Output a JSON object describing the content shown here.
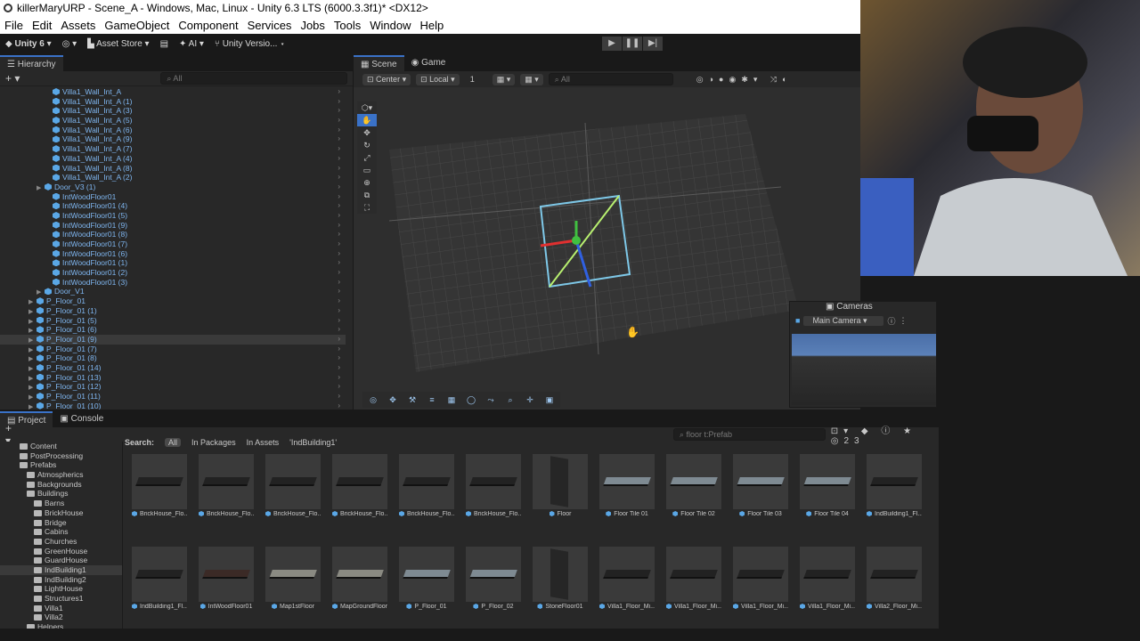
{
  "window_title": "killerMaryURP - Scene_A - Windows, Mac, Linux - Unity 6.3 LTS (6000.3.3f1)* <DX12>",
  "menu": [
    "File",
    "Edit",
    "Assets",
    "GameObject",
    "Component",
    "Services",
    "Jobs",
    "Tools",
    "Window",
    "Help"
  ],
  "toolbar": {
    "account": "Unity 6",
    "asset_store": "Asset Store",
    "ai": "AI",
    "version_control": "Unity Versio..."
  },
  "hierarchy": {
    "tab": "Hierarchy",
    "search_placeholder": "All",
    "rows": [
      {
        "name": "Villa1_Wall_Int_A",
        "indent": 4,
        "selected": false
      },
      {
        "name": "Villa1_Wall_Int_A (1)",
        "indent": 4,
        "selected": false
      },
      {
        "name": "Villa1_Wall_Int_A (3)",
        "indent": 4,
        "selected": false
      },
      {
        "name": "Villa1_Wall_Int_A (5)",
        "indent": 4,
        "selected": false
      },
      {
        "name": "Villa1_Wall_Int_A (6)",
        "indent": 4,
        "selected": false
      },
      {
        "name": "Villa1_Wall_Int_A (9)",
        "indent": 4,
        "selected": false
      },
      {
        "name": "Villa1_Wall_Int_A (7)",
        "indent": 4,
        "selected": false
      },
      {
        "name": "Villa1_Wall_Int_A (4)",
        "indent": 4,
        "selected": false
      },
      {
        "name": "Villa1_Wall_Int_A (8)",
        "indent": 4,
        "selected": false
      },
      {
        "name": "Villa1_Wall_Int_A (2)",
        "indent": 4,
        "selected": false
      },
      {
        "name": "Door_V3 (1)",
        "indent": 3,
        "selected": false
      },
      {
        "name": "IntWoodFloor01",
        "indent": 4,
        "selected": false
      },
      {
        "name": "IntWoodFloor01 (4)",
        "indent": 4,
        "selected": false
      },
      {
        "name": "IntWoodFloor01 (5)",
        "indent": 4,
        "selected": false
      },
      {
        "name": "IntWoodFloor01 (9)",
        "indent": 4,
        "selected": false
      },
      {
        "name": "IntWoodFloor01 (8)",
        "indent": 4,
        "selected": false
      },
      {
        "name": "IntWoodFloor01 (7)",
        "indent": 4,
        "selected": false
      },
      {
        "name": "IntWoodFloor01 (6)",
        "indent": 4,
        "selected": false
      },
      {
        "name": "IntWoodFloor01 (1)",
        "indent": 4,
        "selected": false
      },
      {
        "name": "IntWoodFloor01 (2)",
        "indent": 4,
        "selected": false
      },
      {
        "name": "IntWoodFloor01 (3)",
        "indent": 4,
        "selected": false
      },
      {
        "name": "Door_V1",
        "indent": 3,
        "selected": false
      },
      {
        "name": "P_Floor_01",
        "indent": 2,
        "selected": false
      },
      {
        "name": "P_Floor_01 (1)",
        "indent": 2,
        "selected": false
      },
      {
        "name": "P_Floor_01 (5)",
        "indent": 2,
        "selected": false
      },
      {
        "name": "P_Floor_01 (6)",
        "indent": 2,
        "selected": false
      },
      {
        "name": "P_Floor_01 (9)",
        "indent": 2,
        "selected": true
      },
      {
        "name": "P_Floor_01 (7)",
        "indent": 2,
        "selected": false
      },
      {
        "name": "P_Floor_01 (8)",
        "indent": 2,
        "selected": false
      },
      {
        "name": "P_Floor_01 (14)",
        "indent": 2,
        "selected": false
      },
      {
        "name": "P_Floor_01 (13)",
        "indent": 2,
        "selected": false
      },
      {
        "name": "P_Floor_01 (12)",
        "indent": 2,
        "selected": false
      },
      {
        "name": "P_Floor_01 (11)",
        "indent": 2,
        "selected": false
      },
      {
        "name": "P_Floor_01 (10)",
        "indent": 2,
        "selected": false
      }
    ]
  },
  "scene": {
    "tabs": [
      "Scene",
      "Game"
    ],
    "pivot": "Center",
    "space": "Local",
    "grid_size": "1",
    "search_placeholder": "All"
  },
  "cameras": {
    "title": "Cameras",
    "selected": "Main Camera"
  },
  "project": {
    "tabs": [
      "Project",
      "Console"
    ],
    "search_value": "floor t:Prefab",
    "count": "23",
    "search_label": "Search:",
    "scopes": [
      "All",
      "In Packages",
      "In Assets",
      "'IndBuilding1'"
    ],
    "tree": [
      {
        "name": "Content",
        "indent": 1,
        "selected": false
      },
      {
        "name": "PostProcessing",
        "indent": 1,
        "selected": false
      },
      {
        "name": "Prefabs",
        "indent": 1,
        "selected": false
      },
      {
        "name": "Atmospherics",
        "indent": 2,
        "selected": false
      },
      {
        "name": "Backgrounds",
        "indent": 2,
        "selected": false
      },
      {
        "name": "Buildings",
        "indent": 2,
        "selected": false
      },
      {
        "name": "Barns",
        "indent": 3,
        "selected": false
      },
      {
        "name": "BrickHouse",
        "indent": 3,
        "selected": false
      },
      {
        "name": "Bridge",
        "indent": 3,
        "selected": false
      },
      {
        "name": "Cabins",
        "indent": 3,
        "selected": false
      },
      {
        "name": "Churches",
        "indent": 3,
        "selected": false
      },
      {
        "name": "GreenHouse",
        "indent": 3,
        "selected": false
      },
      {
        "name": "GuardHouse",
        "indent": 3,
        "selected": false
      },
      {
        "name": "IndBuilding1",
        "indent": 3,
        "selected": true
      },
      {
        "name": "IndBuilding2",
        "indent": 3,
        "selected": false
      },
      {
        "name": "LightHouse",
        "indent": 3,
        "selected": false
      },
      {
        "name": "Structures1",
        "indent": 3,
        "selected": false
      },
      {
        "name": "Villa1",
        "indent": 3,
        "selected": false
      },
      {
        "name": "Villa2",
        "indent": 3,
        "selected": false
      },
      {
        "name": "Helpers",
        "indent": 2,
        "selected": false
      }
    ],
    "assets": [
      {
        "label": "BrickHouse_Flo...",
        "kind": "dark"
      },
      {
        "label": "BrickHouse_Flo...",
        "kind": "dark"
      },
      {
        "label": "BrickHouse_Flo...",
        "kind": "dark"
      },
      {
        "label": "BrickHouse_Flo...",
        "kind": "dark"
      },
      {
        "label": "BrickHouse_Flo...",
        "kind": "dark"
      },
      {
        "label": "BrickHouse_Flo...",
        "kind": "dark"
      },
      {
        "label": "Floor",
        "kind": "wall"
      },
      {
        "label": "Floor Tile 01",
        "kind": "light"
      },
      {
        "label": "Floor Tile 02",
        "kind": "light"
      },
      {
        "label": "Floor Tile 03",
        "kind": "light"
      },
      {
        "label": "Floor Tile 04",
        "kind": "light"
      },
      {
        "label": "IndBuilding1_Fl...",
        "kind": "dark"
      },
      {
        "label": "IndBuilding1_Fl...",
        "kind": "dark"
      },
      {
        "label": "IntWoodFloor01",
        "kind": "wood"
      },
      {
        "label": "Map1stFloor",
        "kind": "stone"
      },
      {
        "label": "MapGroundFloor",
        "kind": "stone"
      },
      {
        "label": "P_Floor_01",
        "kind": "light"
      },
      {
        "label": "P_Floor_02",
        "kind": "light"
      },
      {
        "label": "StoneFloor01",
        "kind": "wall"
      },
      {
        "label": "Villa1_Floor_Mi...",
        "kind": "dark"
      },
      {
        "label": "Villa1_Floor_Mi...",
        "kind": "dark"
      },
      {
        "label": "Villa1_Floor_Mi...",
        "kind": "dark"
      },
      {
        "label": "Villa1_Floor_Mi...",
        "kind": "dark"
      },
      {
        "label": "Villa2_Floor_Mi...",
        "kind": "dark"
      }
    ]
  }
}
